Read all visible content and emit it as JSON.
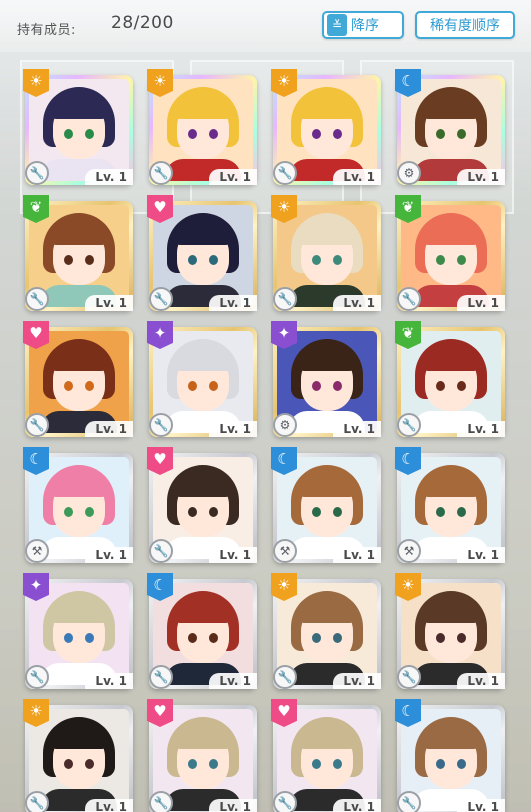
{
  "header": {
    "owned_label": "持有成员:",
    "owned_count": "28/200",
    "sort_button": {
      "icon": "sort-down-icon",
      "label": "降序"
    },
    "rarity_button": {
      "label": "稀有度顺序"
    }
  },
  "colors": {
    "accent": "#41a9d8",
    "attr_orange": "#f0a11e",
    "attr_green": "#46b53c",
    "attr_pink": "#ef4b86",
    "attr_blue": "#2d8fd9",
    "attr_purple": "#8a4fd0"
  },
  "cards": [
    {
      "rarity": "rainbow",
      "attr": "orange",
      "attr_icon": "sun-icon",
      "type_icon": "wrench-icon",
      "level": "Lv. 1",
      "hair": "#2c2a55",
      "eye": "#2a8a4a",
      "cloth": "#e9e3f2",
      "bg": "#f3e7f0"
    },
    {
      "rarity": "rainbow",
      "attr": "orange",
      "attr_icon": "sun-icon",
      "type_icon": "wrench-icon",
      "level": "Lv. 1",
      "hair": "#f2c23a",
      "eye": "#6a2b8c",
      "cloth": "#c22a2a",
      "bg": "#ffe2c0"
    },
    {
      "rarity": "rainbow",
      "attr": "orange",
      "attr_icon": "sun-icon",
      "type_icon": "wrench-icon",
      "level": "Lv. 1",
      "hair": "#f2c23a",
      "eye": "#6a2b8c",
      "cloth": "#c22a2a",
      "bg": "#ffe2c0"
    },
    {
      "rarity": "rainbow",
      "attr": "blue",
      "attr_icon": "moon-icon",
      "type_icon": "gear-icon",
      "level": "Lv. 1",
      "hair": "#6a3d22",
      "eye": "#3b6b2a",
      "cloth": "#b33a3a",
      "bg": "#f7e7d6"
    },
    {
      "rarity": "gold",
      "attr": "green",
      "attr_icon": "leaf-icon",
      "type_icon": "wrench-icon",
      "level": "Lv. 1",
      "hair": "#8a4a28",
      "eye": "#5a2e1a",
      "cloth": "#8fc8b8",
      "bg": "#f6cf8a"
    },
    {
      "rarity": "gold",
      "attr": "pink",
      "attr_icon": "heart-icon",
      "type_icon": "wrench-icon",
      "level": "Lv. 1",
      "hair": "#1f1e3a",
      "eye": "#2a6a7a",
      "cloth": "#2b2b3a",
      "bg": "#cfd6e3"
    },
    {
      "rarity": "gold",
      "attr": "orange",
      "attr_icon": "sun-icon",
      "type_icon": "wrench-icon",
      "level": "Lv. 1",
      "hair": "#e9dcc0",
      "eye": "#3e8a7a",
      "cloth": "#2c3a2c",
      "bg": "#f3c889"
    },
    {
      "rarity": "gold",
      "attr": "green",
      "attr_icon": "leaf-icon",
      "type_icon": "wrench-icon",
      "level": "Lv. 1",
      "hair": "#ec6d55",
      "eye": "#3e8a4a",
      "cloth": "#c44040",
      "bg": "#ffb987"
    },
    {
      "rarity": "gold",
      "attr": "pink",
      "attr_icon": "heart-icon",
      "type_icon": "wrench-icon",
      "level": "Lv. 1",
      "hair": "#7a3018",
      "eye": "#d06a1a",
      "cloth": "#2b2b3a",
      "bg": "#f0a24a"
    },
    {
      "rarity": "gold",
      "attr": "purple",
      "attr_icon": "star-icon",
      "type_icon": "wrench-icon",
      "level": "Lv. 1",
      "hair": "#d9d9e0",
      "eye": "#c6621a",
      "cloth": "#ffffff",
      "bg": "#e8eaf0"
    },
    {
      "rarity": "gold",
      "attr": "purple",
      "attr_icon": "star-icon",
      "type_icon": "gear-icon",
      "level": "Lv. 1",
      "hair": "#3a2418",
      "eye": "#8a2a6a",
      "cloth": "#ffffff",
      "bg": "#4a56b8"
    },
    {
      "rarity": "gold",
      "attr": "green",
      "attr_icon": "leaf-icon",
      "type_icon": "wrench-icon",
      "level": "Lv. 1",
      "hair": "#9a2a22",
      "eye": "#6a2a1a",
      "cloth": "#ffffff",
      "bg": "#e0eef0"
    },
    {
      "rarity": "silver",
      "attr": "blue",
      "attr_icon": "moon-icon",
      "type_icon": "hammer-icon",
      "level": "Lv. 1",
      "hair": "#ef7fa6",
      "eye": "#3e9a5a",
      "cloth": "#ffffff",
      "bg": "#dff0fb"
    },
    {
      "rarity": "silver",
      "attr": "pink",
      "attr_icon": "heart-icon",
      "type_icon": "wrench-icon",
      "level": "Lv. 1",
      "hair": "#3a2a22",
      "eye": "#3a2a22",
      "cloth": "#ffffff",
      "bg": "#f8eee6"
    },
    {
      "rarity": "silver",
      "attr": "blue",
      "attr_icon": "moon-icon",
      "type_icon": "hammer-icon",
      "level": "Lv. 1",
      "hair": "#a66a3a",
      "eye": "#2a6a4a",
      "cloth": "#ffffff",
      "bg": "#e6f1f6"
    },
    {
      "rarity": "silver",
      "attr": "blue",
      "attr_icon": "moon-icon",
      "type_icon": "hammer-icon",
      "level": "Lv. 1",
      "hair": "#a66a3a",
      "eye": "#2a6a4a",
      "cloth": "#ffffff",
      "bg": "#e6f1f6"
    },
    {
      "rarity": "silver",
      "attr": "purple",
      "attr_icon": "star-icon",
      "type_icon": "wrench-icon",
      "level": "Lv. 1",
      "hair": "#cfc6a3",
      "eye": "#3a7ab8",
      "cloth": "#ffffff",
      "bg": "#f2e2f2"
    },
    {
      "rarity": "silver",
      "attr": "blue",
      "attr_icon": "moon-icon",
      "type_icon": "wrench-icon",
      "level": "Lv. 1",
      "hair": "#a23024",
      "eye": "#5a2a1a",
      "cloth": "#1f2838",
      "bg": "#f2dede"
    },
    {
      "rarity": "silver",
      "attr": "orange",
      "attr_icon": "sun-icon",
      "type_icon": "wrench-icon",
      "level": "Lv. 1",
      "hair": "#9a6a42",
      "eye": "#3a6a7a",
      "cloth": "#2b2b2b",
      "bg": "#f7ead9"
    },
    {
      "rarity": "silver",
      "attr": "orange",
      "attr_icon": "sun-icon",
      "type_icon": "wrench-icon",
      "level": "Lv. 1",
      "hair": "#5a3a26",
      "eye": "#4a2a2a",
      "cloth": "#2b2b2b",
      "bg": "#f6e0c8"
    },
    {
      "rarity": "silver",
      "attr": "orange",
      "attr_icon": "sun-icon",
      "type_icon": "wrench-icon",
      "level": "Lv. 1",
      "hair": "#1f1a18",
      "eye": "#4a2a2a",
      "cloth": "#2b2b2b",
      "bg": "#ece8e4"
    },
    {
      "rarity": "silver",
      "attr": "pink",
      "attr_icon": "heart-icon",
      "type_icon": "wrench-icon",
      "level": "Lv. 1",
      "hair": "#c9b890",
      "eye": "#3a7a8a",
      "cloth": "#2b2b2b",
      "bg": "#f2e6f0"
    },
    {
      "rarity": "silver",
      "attr": "pink",
      "attr_icon": "heart-icon",
      "type_icon": "wrench-icon",
      "level": "Lv. 1",
      "hair": "#c9b890",
      "eye": "#3a7a8a",
      "cloth": "#2b2b2b",
      "bg": "#f2e6f0"
    },
    {
      "rarity": "silver",
      "attr": "blue",
      "attr_icon": "moon-icon",
      "type_icon": "wrench-icon",
      "level": "Lv. 1",
      "hair": "#9a6a44",
      "eye": "#3a6a8a",
      "cloth": "#ffffff",
      "bg": "#e6eef6"
    }
  ]
}
